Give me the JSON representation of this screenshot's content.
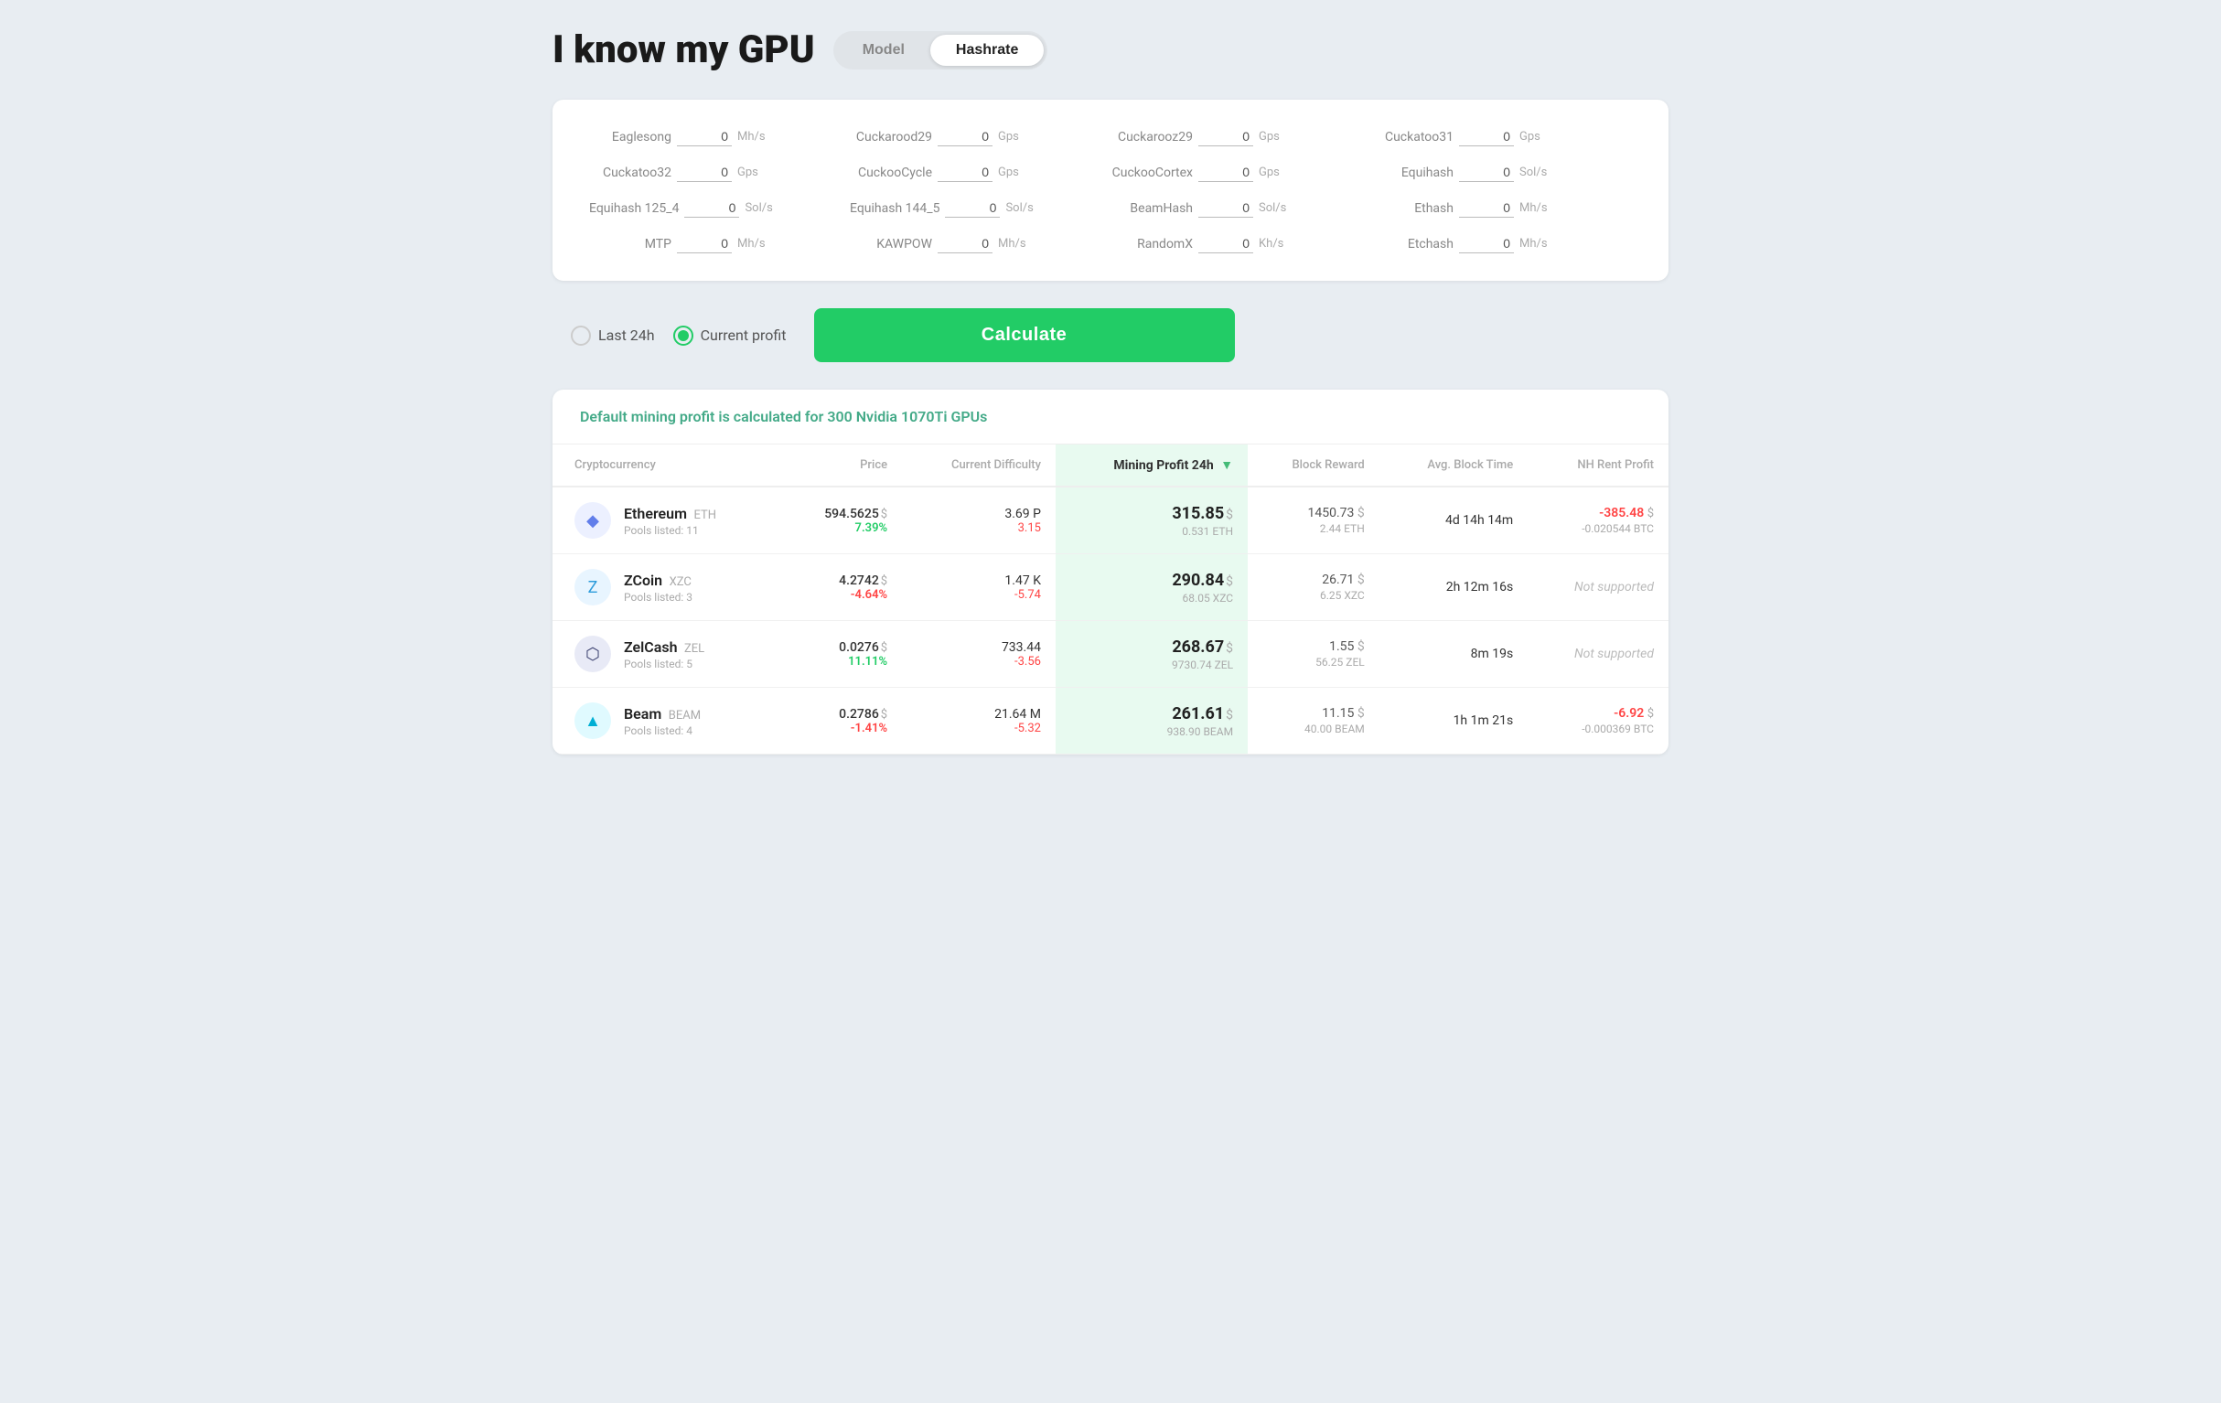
{
  "header": {
    "title": "I know my GPU",
    "mode_model": "Model",
    "mode_hashrate": "Hashrate",
    "active_mode": "hashrate"
  },
  "hashrate_panel": {
    "fields": [
      {
        "label": "Eaglesong",
        "value": "0",
        "unit": "Mh/s"
      },
      {
        "label": "Cuckarood29",
        "value": "0",
        "unit": "Gps"
      },
      {
        "label": "Cuckarooz29",
        "value": "0",
        "unit": "Gps"
      },
      {
        "label": "Cuckatoo31",
        "value": "0",
        "unit": "Gps"
      },
      {
        "label": "Cuckatoo32",
        "value": "0",
        "unit": "Gps"
      },
      {
        "label": "CuckooCycle",
        "value": "0",
        "unit": "Gps"
      },
      {
        "label": "CuckooCortex",
        "value": "0",
        "unit": "Gps"
      },
      {
        "label": "Equihash",
        "value": "0",
        "unit": "Sol/s"
      },
      {
        "label": "Equihash 125_4",
        "value": "0",
        "unit": "Sol/s"
      },
      {
        "label": "Equihash 144_5",
        "value": "0",
        "unit": "Sol/s"
      },
      {
        "label": "BeamHash",
        "value": "0",
        "unit": "Sol/s"
      },
      {
        "label": "Ethash",
        "value": "0",
        "unit": "Mh/s"
      },
      {
        "label": "MTP",
        "value": "0",
        "unit": "Mh/s"
      },
      {
        "label": "KAWPOW",
        "value": "0",
        "unit": "Mh/s"
      },
      {
        "label": "RandomX",
        "value": "0",
        "unit": "Kh/s"
      },
      {
        "label": "Etchash",
        "value": "0",
        "unit": "Mh/s"
      }
    ]
  },
  "calc_options": {
    "last24h_label": "Last 24h",
    "current_profit_label": "Current profit",
    "selected": "current_profit",
    "calculate_btn": "Calculate"
  },
  "results": {
    "subtitle": "Default mining profit is calculated for 300 Nvidia 1070Ti GPUs",
    "table_headers": {
      "cryptocurrency": "Cryptocurrency",
      "price": "Price",
      "current_difficulty": "Current Difficulty",
      "mining_profit_24h": "Mining Profit 24h",
      "block_reward": "Block Reward",
      "avg_block_time": "Avg. Block Time",
      "nh_rent_profit": "NH Rent Profit"
    },
    "rows": [
      {
        "name": "Ethereum",
        "symbol": "ETH",
        "pools": "11",
        "price": "594.5625",
        "price_change": "7.39%",
        "price_change_positive": true,
        "difficulty": "3.69 P",
        "difficulty_change": "3.15",
        "difficulty_change_negative": true,
        "profit_value": "315.85",
        "profit_coin": "0.531 ETH",
        "block_reward_usd": "1450.73",
        "block_reward_coin": "2.44 ETH",
        "avg_block_time": "4d 14h 14m",
        "nh_rent": "-385.48",
        "nh_rent_btc": "-0.020544 BTC",
        "logo_color": "#627eea",
        "logo_symbol": "◈"
      },
      {
        "name": "ZCoin",
        "symbol": "XZC",
        "pools": "3",
        "price": "4.2742",
        "price_change": "-4.64%",
        "price_change_positive": false,
        "difficulty": "1.47 K",
        "difficulty_change": "-5.74",
        "difficulty_change_negative": true,
        "profit_value": "290.84",
        "profit_coin": "68.05 XZC",
        "block_reward_usd": "26.71",
        "block_reward_coin": "6.25 XZC",
        "avg_block_time": "2h 12m 16s",
        "nh_rent": "Not supported",
        "nh_rent_btc": "",
        "logo_color": "#2d9cdb",
        "logo_symbol": "Z"
      },
      {
        "name": "ZelCash",
        "symbol": "ZEL",
        "pools": "5",
        "price": "0.0276",
        "price_change": "11.11%",
        "price_change_positive": true,
        "difficulty": "733.44",
        "difficulty_change": "-3.56",
        "difficulty_change_negative": true,
        "profit_value": "268.67",
        "profit_coin": "9730.74 ZEL",
        "block_reward_usd": "1.55",
        "block_reward_coin": "56.25 ZEL",
        "avg_block_time": "8m 19s",
        "nh_rent": "Not supported",
        "nh_rent_btc": "",
        "logo_color": "#1a1a2e",
        "logo_symbol": "⬡"
      },
      {
        "name": "Beam",
        "symbol": "BEAM",
        "pools": "4",
        "price": "0.2786",
        "price_change": "-1.41%",
        "price_change_positive": false,
        "difficulty": "21.64 M",
        "difficulty_change": "-5.32",
        "difficulty_change_negative": true,
        "profit_value": "261.61",
        "profit_coin": "938.90 BEAM",
        "block_reward_usd": "11.15",
        "block_reward_coin": "40.00 BEAM",
        "avg_block_time": "1h 1m 21s",
        "nh_rent": "-6.92",
        "nh_rent_btc": "-0.000369 BTC",
        "logo_color": "#00d2ff",
        "logo_symbol": "▲"
      }
    ]
  },
  "icons": {
    "sort_down": "▼"
  }
}
